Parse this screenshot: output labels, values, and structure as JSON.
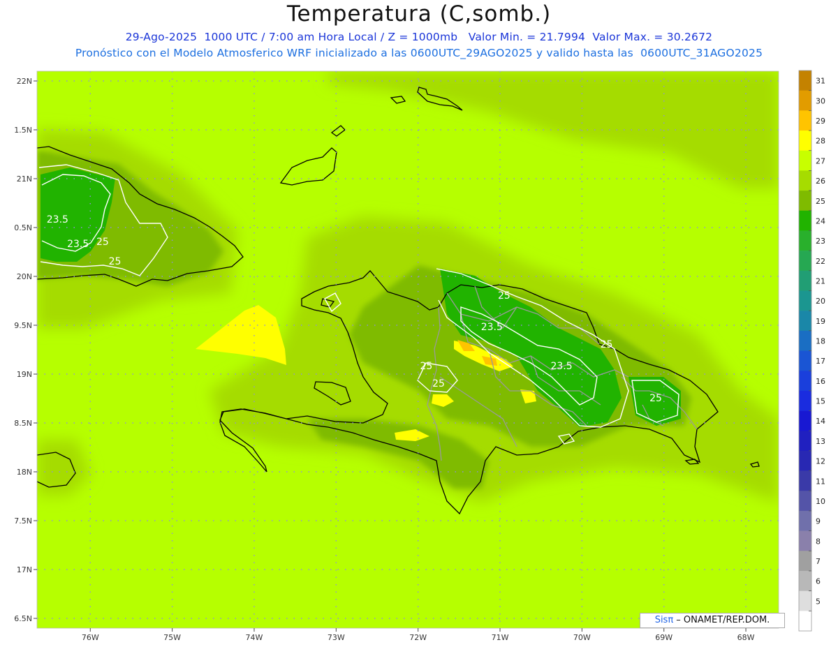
{
  "map": {
    "title": "Temperatura (C,somb.)",
    "date": "29-Ago-2025",
    "utc_time": "1000 UTC",
    "local_time": "7:00 am Hora Local",
    "level": "Z = 1000mb",
    "min_label": "Valor Min. = 21.7994",
    "max_label": "Valor Max. = 30.2672",
    "model_note": "Pronóstico con el Modelo Atmosferico WRF inicializado a las 0600UTC_29AGO2025 y valido hasta las  0600UTC_31AGO2025",
    "extent": {
      "lon": [
        -76.65,
        -67.6
      ],
      "lat": [
        16.4,
        22.1
      ]
    },
    "lat_labels": [
      "22N",
      "1.5N",
      "21N",
      "0.5N",
      "20N",
      "9.5N",
      "19N",
      "8.5N",
      "18N",
      "7.5N",
      "17N",
      "6.5N"
    ],
    "lat_values": [
      22,
      21.5,
      21,
      20.5,
      20,
      19.5,
      19,
      18.5,
      18,
      17.5,
      17,
      16.5
    ],
    "lon_labels": [
      "76W",
      "75W",
      "74W",
      "73W",
      "72W",
      "71W",
      "70W",
      "69W",
      "68W"
    ],
    "lon_values": [
      -76,
      -75,
      -74,
      -73,
      -72,
      -71,
      -70,
      -69,
      -68
    ],
    "contour_labels": [
      {
        "text": "23.5",
        "lon": -76.4,
        "lat": 20.55
      },
      {
        "text": "23.5",
        "lon": -76.15,
        "lat": 20.3
      },
      {
        "text": "25",
        "lon": -75.85,
        "lat": 20.32
      },
      {
        "text": "25",
        "lon": -75.7,
        "lat": 20.12
      },
      {
        "text": "25",
        "lon": -70.95,
        "lat": 19.77
      },
      {
        "text": "23.5",
        "lon": -71.1,
        "lat": 19.45
      },
      {
        "text": "25",
        "lon": -69.7,
        "lat": 19.27
      },
      {
        "text": "23.5",
        "lon": -70.25,
        "lat": 19.05
      },
      {
        "text": "25",
        "lon": -71.9,
        "lat": 19.05
      },
      {
        "text": "25",
        "lon": -71.75,
        "lat": 18.87
      },
      {
        "text": "25",
        "lon": -69.1,
        "lat": 18.72
      }
    ]
  },
  "legend": {
    "labels": [
      "31",
      "30",
      "29",
      "28",
      "27",
      "26",
      "25",
      "24",
      "23",
      "22",
      "21",
      "20",
      "19",
      "18",
      "17",
      "16",
      "15",
      "14",
      "13",
      "12",
      "11",
      "10",
      "9",
      "8",
      "7",
      "6",
      "5"
    ],
    "colors": [
      "#c48200",
      "#e29c00",
      "#ffc400",
      "#ffff00",
      "#c8ff00",
      "#a6dc00",
      "#7fbb00",
      "#21b300",
      "#29b02c",
      "#26a852",
      "#219e74",
      "#1b9690",
      "#1a87a8",
      "#1a6ec3",
      "#1a55d4",
      "#1a3fdc",
      "#1a2cdf",
      "#1818d2",
      "#2020c0",
      "#2828b3",
      "#3a3aa8",
      "#5454a8",
      "#7070ab",
      "#8a80ab",
      "#a0a0a0",
      "#b8b8b8",
      "#dedede",
      "#ffffff"
    ]
  },
  "credit": {
    "brand": "Sisπ",
    "text": " – ONAMET/REP.DOM."
  }
}
